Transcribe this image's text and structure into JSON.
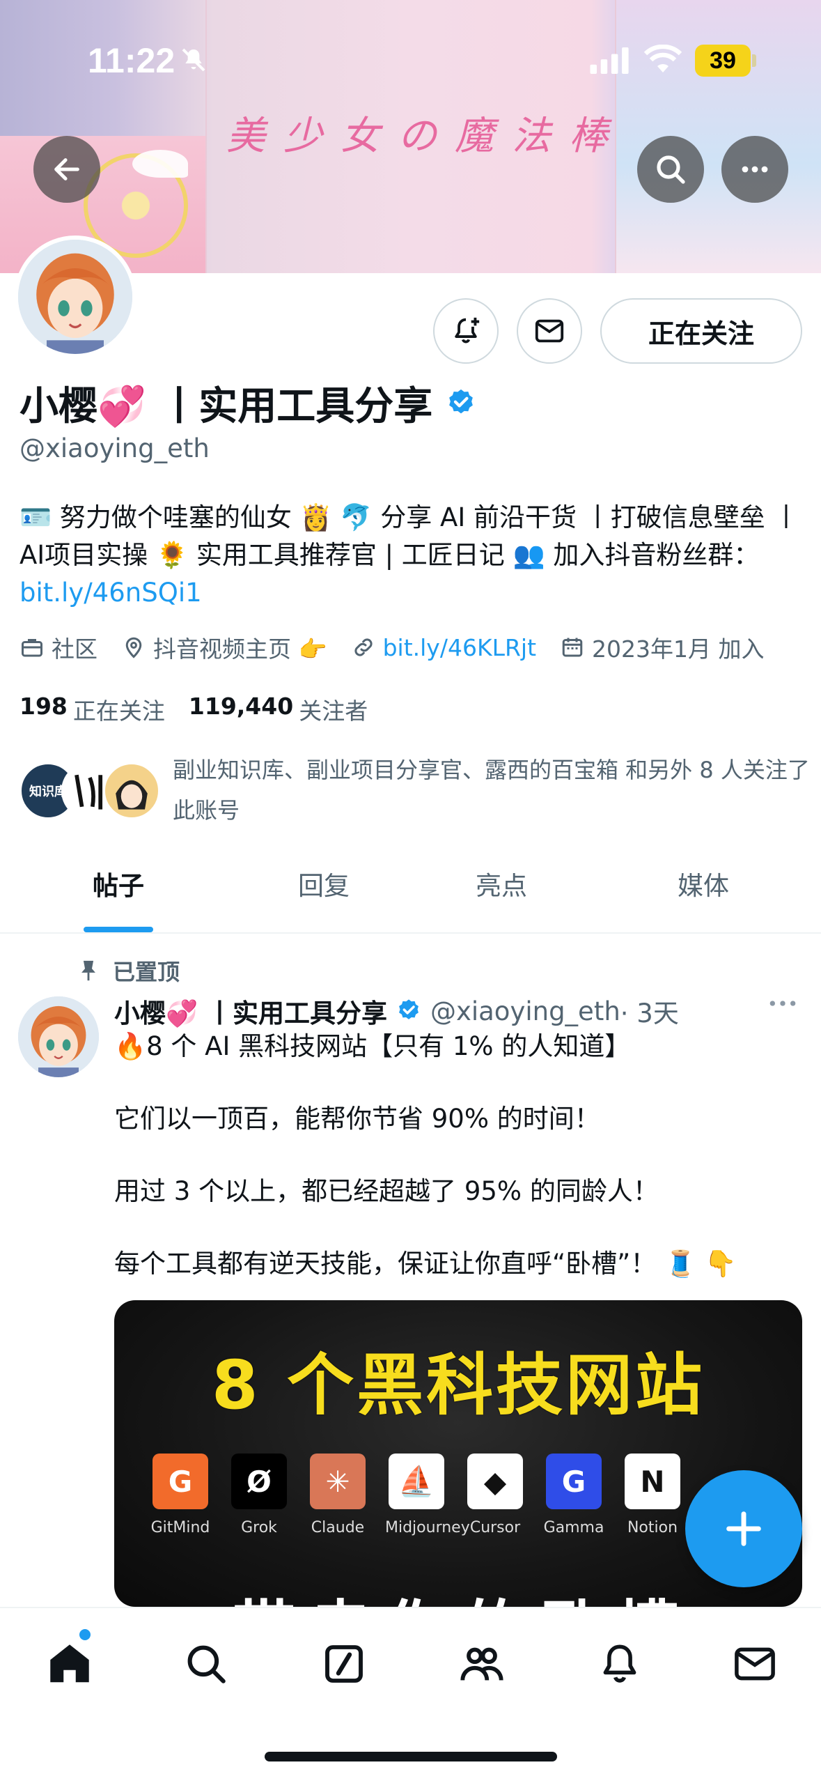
{
  "status_bar": {
    "time": "11:22",
    "battery": "39"
  },
  "banner": {
    "title": "美少女の魔法棒"
  },
  "profile": {
    "follow_button": "正在关注",
    "display_name": "小樱💞 丨实用工具分享",
    "handle": "@xiaoying_eth",
    "bio_text": "🪪 努力做个哇塞的仙女 👸 🐬 分享 AI 前沿干货 丨打破信息壁垒 丨AI项目实操 🌻 实用工具推荐官 | 工匠日记 👥 加入抖音粉丝群：",
    "bio_link": "bit.ly/46nSQi1",
    "category": "社区",
    "location": "抖音视频主页 👉",
    "website": "bit.ly/46KLRjt",
    "joined": "2023年1月 加入",
    "following_count": "198",
    "following_label": "正在关注",
    "followers_count": "119,440",
    "followers_label": "关注者",
    "followed_by_text": "副业知识库、副业项目分享官、露西的百宝箱 和另外 8 人关注了此账号",
    "mini_avatar_text": "知识库"
  },
  "tabs": [
    {
      "label": "帖子",
      "active": true
    },
    {
      "label": "回复",
      "active": false
    },
    {
      "label": "亮点",
      "active": false
    },
    {
      "label": "媒体",
      "active": false
    }
  ],
  "post": {
    "pinned_label": "已置顶",
    "author_name": "小樱💞 丨实用工具分享",
    "author_handle": "@xiaoying_eth",
    "time": "· 3天",
    "lines": [
      "🔥8 个 AI 黑科技网站【只有 1% 的人知道】",
      "它们以一顶百，能帮你节省 90% 的时间！",
      "用过 3 个以上，都已经超越了 95% 的同龄人！",
      "每个工具都有逆天技能，保证让你直呼“卧槽”！ 🧵 👇"
    ],
    "media": {
      "headline": "8 个黑科技网站",
      "bottom_text": "带走你的卧槽",
      "tools": [
        {
          "name": "GitMind",
          "icon": "gitmind-icon",
          "color": "#f26b2b",
          "glyph": "G"
        },
        {
          "name": "Grok",
          "icon": "grok-icon",
          "color": "#000000",
          "glyph": "Ø"
        },
        {
          "name": "Claude",
          "icon": "claude-icon",
          "color": "#d97757",
          "glyph": "✳"
        },
        {
          "name": "Midjourney",
          "icon": "midjourney-icon",
          "color": "#ffffff",
          "glyph": "⛵"
        },
        {
          "name": "Cursor",
          "icon": "cursor-icon",
          "color": "#ffffff",
          "glyph": "◆"
        },
        {
          "name": "Gamma",
          "icon": "gamma-icon",
          "color": "#2f4de8",
          "glyph": "G"
        },
        {
          "name": "Notion",
          "icon": "notion-icon",
          "color": "#ffffff",
          "glyph": "N"
        }
      ]
    }
  },
  "colors": {
    "accent": "#1d9bf0",
    "text": "#0f1419",
    "muted": "#536471"
  }
}
